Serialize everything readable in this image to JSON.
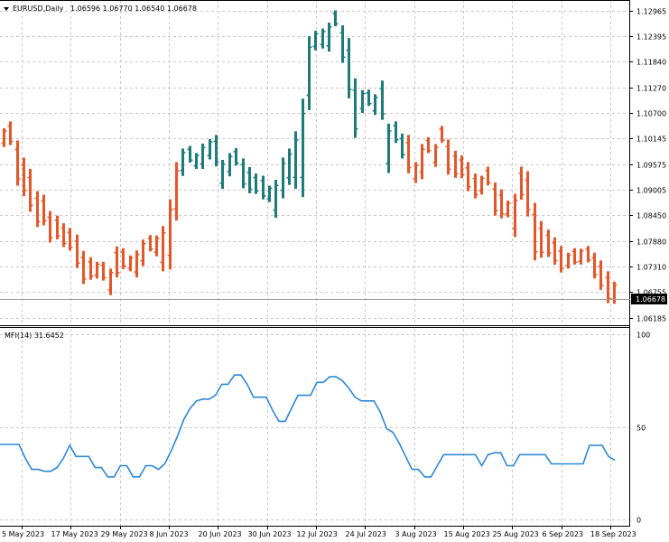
{
  "main": {
    "title": "EURUSD,Daily",
    "ohlc_text": "1.06596 1.06770 1.06540 1.06678",
    "current_price_label": "1.06678"
  },
  "indicator": {
    "title": "MFI(14) 31.6452"
  },
  "colors": {
    "bull": "#1f7a7a",
    "bear": "#e2582a",
    "mfi_line": "#2f87d4",
    "grid": "#c8c8c8",
    "axis": "#000000",
    "price_tag_bg": "#000000",
    "price_tag_text": "#ffffff"
  },
  "chart_data": [
    {
      "type": "bar",
      "subtype": "ohlc",
      "title": "EURUSD,Daily",
      "y_ticks": [
        "1.12965",
        "1.12395",
        "1.11840",
        "1.11270",
        "1.10700",
        "1.10145",
        "1.09575",
        "1.09005",
        "1.08450",
        "1.07880",
        "1.07310",
        "1.06755",
        "1.06185"
      ],
      "ylim": [
        1.0608,
        1.1302
      ],
      "x_tick_labels": [
        "5 May 2023",
        "17 May 2023",
        "29 May 2023",
        "8 Jun 2023",
        "20 Jun 2023",
        "30 Jun 2023",
        "12 Jul 2023",
        "24 Jul 2023",
        "3 Aug 2023",
        "15 Aug 2023",
        "25 Aug 2023",
        "6 Sep 2023",
        "18 Sep 2023"
      ],
      "grid": true,
      "series": [
        {
          "values_high": [
            1.1037,
            1.1052,
            1.101,
            1.0972,
            1.0947,
            1.0898,
            1.089,
            1.0854,
            1.0844,
            1.0827,
            1.0817,
            1.0802,
            1.0766,
            1.0752,
            1.0742,
            1.0742,
            1.0727,
            1.0776,
            1.0772,
            1.0756,
            1.0767,
            1.0791,
            1.0801,
            1.08,
            1.0821,
            1.088,
            1.0962,
            1.0992,
            1.0998,
            1.0982,
            1.1003,
            1.1013,
            1.1022,
            1.0967,
            1.0982,
            1.0993,
            1.097,
            1.0951,
            1.0937,
            1.0932,
            1.091,
            1.0923,
            1.0972,
            1.0992,
            1.103,
            1.1102,
            1.124,
            1.1252,
            1.1257,
            1.127,
            1.1297,
            1.1264,
            1.1236,
            1.1147,
            1.1121,
            1.1122,
            1.1112,
            1.1142,
            1.1047,
            1.1052,
            1.1025,
            1.1022,
            1.0962,
            1.1002,
            1.1017,
            1.1002,
            1.1042,
            1.1012,
            1.0987,
            1.0977,
            1.0962,
            1.0937,
            1.0932,
            1.0952,
            1.0917,
            1.0902,
            1.0877,
            1.0892,
            1.0952,
            1.0942,
            1.0872,
            1.0832,
            1.0813,
            1.0796,
            1.0777,
            1.0762,
            1.0772,
            1.0771,
            1.0777,
            1.0762,
            1.0745,
            1.0721,
            1.0698
          ]
        }
      ]
    },
    {
      "type": "line",
      "title": "MFI(14) 31.6452",
      "y_ticks": [
        "100",
        "50",
        "0"
      ],
      "ylim": [
        0,
        100
      ],
      "grid": true,
      "series": [
        {
          "values": [
            40.5,
            40.5,
            40.5,
            40.5,
            33,
            27,
            27,
            26,
            26,
            28,
            33,
            40,
            34,
            34,
            34,
            28,
            28,
            23,
            23,
            29,
            29,
            23,
            23,
            29,
            29,
            27,
            30,
            37,
            45,
            54,
            60,
            64,
            65,
            65,
            67,
            73,
            73,
            78,
            78,
            73,
            66,
            66,
            66,
            59,
            53,
            53,
            60,
            67,
            67,
            67,
            74,
            74,
            77,
            77,
            75,
            71,
            66,
            64,
            64,
            64,
            58,
            49,
            47,
            41,
            34,
            27,
            27,
            23,
            23,
            29,
            35,
            35,
            35,
            35,
            35,
            35,
            29,
            35,
            36,
            36,
            29,
            29,
            35,
            35,
            35,
            35,
            35,
            30,
            30,
            30,
            30,
            30,
            30,
            40,
            40,
            40,
            34,
            32
          ]
        }
      ]
    }
  ]
}
